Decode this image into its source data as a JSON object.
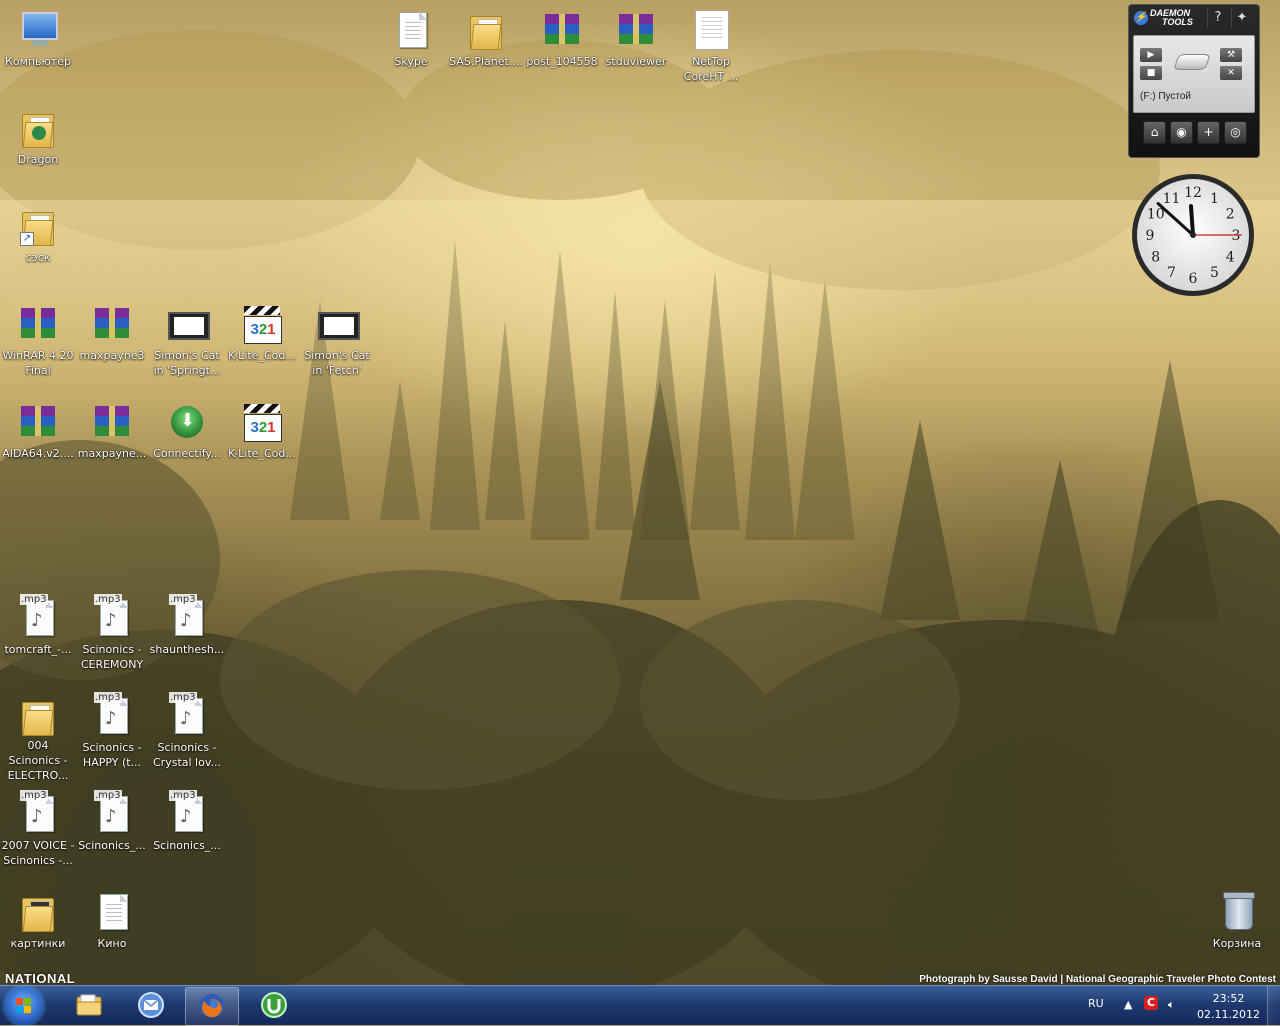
{
  "desktop": {
    "icons": [
      {
        "label": "Компьютер"
      },
      {
        "label": "Dragon"
      },
      {
        "label": "сэск"
      },
      {
        "label": "WinRAR 4.20 Final"
      },
      {
        "label": "maxpayne3"
      },
      {
        "label": "Simon's Cat in 'Springt..."
      },
      {
        "label": "K-Lite_Cod..."
      },
      {
        "label": "Simon's Cat in 'Fetch'"
      },
      {
        "label": "AIDA64.v2...."
      },
      {
        "label": "maxpayne..."
      },
      {
        "label": "Connectify..."
      },
      {
        "label": "K-Lite_Cod..."
      },
      {
        "label": "tomcraft_-..."
      },
      {
        "label": "Scinonics - CEREMONY"
      },
      {
        "label": "shaunthesh..."
      },
      {
        "label": "004 Scinonics - ELECTRO..."
      },
      {
        "label": "Scinonics - HAPPY (t..."
      },
      {
        "label": "Scinonics - Crystal lov..."
      },
      {
        "label": "2007 VOICE - Scinonics -..."
      },
      {
        "label": "Scinonics_..."
      },
      {
        "label": "Scinonics_..."
      },
      {
        "label": "картинки"
      },
      {
        "label": "Кино"
      },
      {
        "label": "Skype"
      },
      {
        "label": "SAS.Planet...."
      },
      {
        "label": "post_104558"
      },
      {
        "label": "stduviewer"
      },
      {
        "label": "NetTop CoreHT ..."
      },
      {
        "label": "Корзина"
      }
    ],
    "mp3_ext": ".mp3",
    "klite_digits": [
      "3",
      "2",
      "1"
    ]
  },
  "wallpaper": {
    "credit_left": "NATIONAL",
    "credit_right": "Photograph by Sausse David | National Geographic Traveler Photo Contest"
  },
  "daemon_tools": {
    "logo_line1": "DAEMON",
    "logo_line2": "TOOLS",
    "help": "?",
    "drive_label": "(F:) Пустой",
    "accent": "#3b7ad8"
  },
  "clock": {
    "numbers": [
      "12",
      "1",
      "2",
      "3",
      "4",
      "5",
      "6",
      "7",
      "8",
      "9",
      "10",
      "11"
    ],
    "hour": 11,
    "minute": 52,
    "second": 15
  },
  "taskbar": {
    "pinned": [
      {
        "name": "explorer",
        "icon": "folder-icon"
      },
      {
        "name": "mail",
        "icon": "mail-icon"
      },
      {
        "name": "firefox",
        "icon": "firefox-icon"
      },
      {
        "name": "utorrent",
        "icon": "utorrent-icon"
      }
    ],
    "language": "RU",
    "time": "23:52",
    "date": "02.11.2012"
  }
}
